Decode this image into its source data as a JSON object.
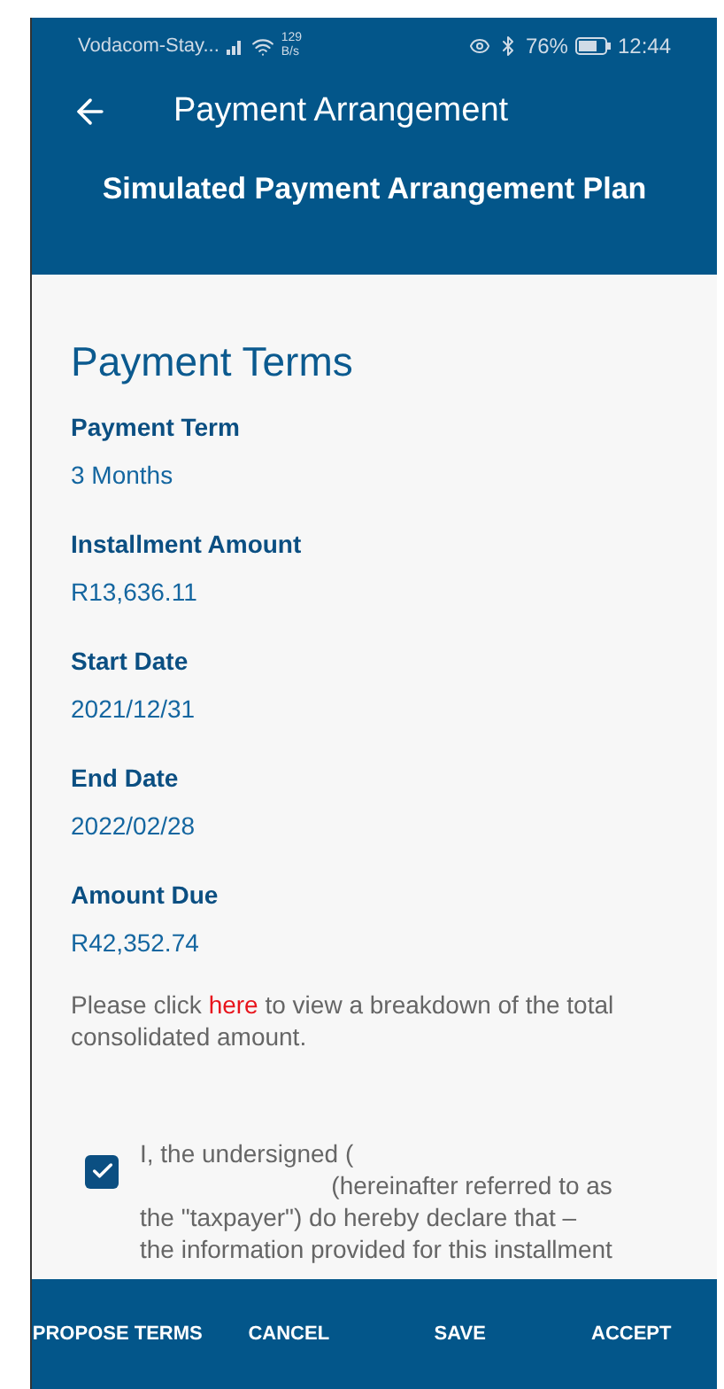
{
  "status_bar": {
    "carrier": "Vodacom-Stay...",
    "speed": "129",
    "speed_unit": "B/s",
    "battery": "76%",
    "time": "12:44"
  },
  "header": {
    "title": "Payment Arrangement",
    "subtitle": "Simulated Payment Arrangement Plan"
  },
  "section_title": "Payment Terms",
  "fields": [
    {
      "label": "Payment Term",
      "value": "3 Months"
    },
    {
      "label": "Installment Amount",
      "value": "R13,636.11"
    },
    {
      "label": "Start Date",
      "value": "2021/12/31"
    },
    {
      "label": "End Date",
      "value": "2022/02/28"
    },
    {
      "label": "Amount Due",
      "value": "R42,352.74"
    }
  ],
  "note": {
    "before": "Please click",
    "link": "here",
    "after": "to view a breakdown of the total consolidated amount."
  },
  "declaration": {
    "checked": true,
    "lines": [
      "I, the undersigned (",
      "(hereinafter referred to as",
      "the \"taxpayer\") do hereby declare that –",
      "the information provided for this installment"
    ]
  },
  "actions": [
    "PROPOSE TERMS",
    "CANCEL",
    "SAVE",
    "ACCEPT"
  ]
}
